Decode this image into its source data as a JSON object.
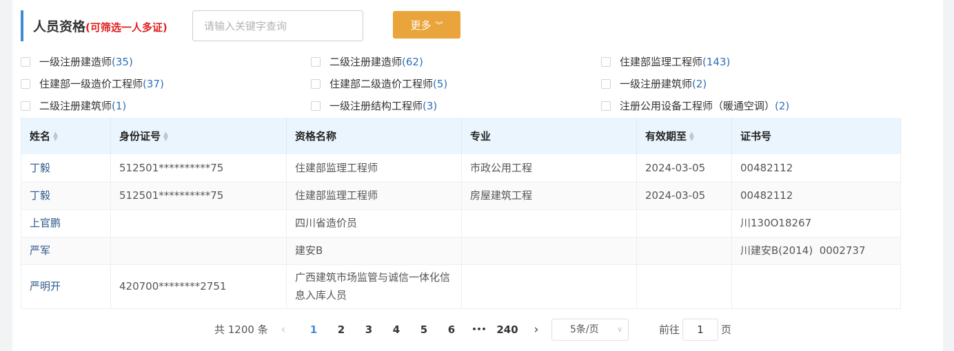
{
  "header": {
    "title": "人员资格",
    "hint": "(可筛选一人多证)",
    "search_placeholder": "请输入关键字查询",
    "more_label": "更多",
    "more_icon": "double-chevron-down"
  },
  "filters": [
    {
      "label": "一级注册建造师",
      "count": "(35)"
    },
    {
      "label": "二级注册建造师",
      "count": "(62)"
    },
    {
      "label": "住建部监理工程师",
      "count": "(143)"
    },
    {
      "label": "住建部一级造价工程师",
      "count": "(37)"
    },
    {
      "label": "住建部二级造价工程师",
      "count": "(5)"
    },
    {
      "label": "一级注册建筑师",
      "count": "(2)"
    },
    {
      "label": "二级注册建筑师",
      "count": "(1)"
    },
    {
      "label": "一级注册结构工程师",
      "count": "(3)"
    },
    {
      "label": "注册公用设备工程师（暖通空调）",
      "count": "(2)"
    }
  ],
  "table": {
    "headers": [
      "姓名",
      "身份证号",
      "资格名称",
      "专业",
      "有效期至",
      "证书号"
    ],
    "rows": [
      [
        "丁毅",
        "512501**********75",
        "住建部监理工程师",
        "市政公用工程",
        "2024-03-05",
        "00482112"
      ],
      [
        "丁毅",
        "512501**********75",
        "住建部监理工程师",
        "房屋建筑工程",
        "2024-03-05",
        "00482112"
      ],
      [
        "上官鹏",
        "",
        "四川省造价员",
        "",
        "",
        "川130O18267"
      ],
      [
        "严军",
        "",
        "建安B",
        "",
        "",
        "川建安B(2014)  0002737"
      ],
      [
        "严明开",
        "420700********2751",
        "广西建筑市场监管与诚信一体化信息入库人员",
        "",
        "",
        ""
      ]
    ]
  },
  "pagination": {
    "total": "共 1200 条",
    "pages": [
      "1",
      "2",
      "3",
      "4",
      "5",
      "6"
    ],
    "ellipsis": "•••",
    "last": "240",
    "current": "1",
    "page_size": "5条/页",
    "goto_prefix": "前往",
    "goto_value": "1",
    "goto_suffix": "页",
    "prev_icon": "chevron-left",
    "next_icon": "chevron-right"
  },
  "colors": {
    "accent": "#3f8ad8",
    "button": "#e9a43b",
    "hint": "#e02020",
    "header_bg": "#eaf5fd"
  }
}
